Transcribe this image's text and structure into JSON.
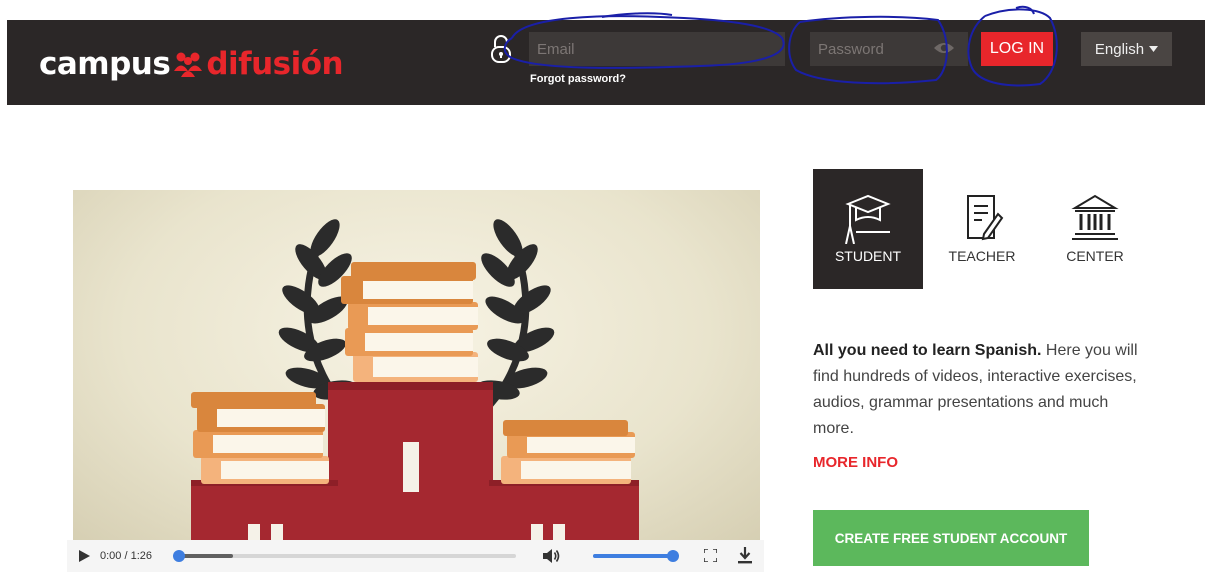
{
  "header": {
    "logo_part1": "campus",
    "logo_part2": "difusión",
    "email_placeholder": "Email",
    "password_placeholder": "Password",
    "forgot_password": "Forgot password?",
    "login_label": "LOG IN",
    "language": "English"
  },
  "video": {
    "time": "0:00 / 1:26",
    "buffered_fraction": 0.16,
    "played_fraction": 0.0,
    "volume_fraction": 1.0
  },
  "tabs": [
    {
      "label": "STUDENT",
      "icon": "graduation-cap-icon",
      "active": true
    },
    {
      "label": "TEACHER",
      "icon": "notepad-pencil-icon",
      "active": false
    },
    {
      "label": "CENTER",
      "icon": "institution-building-icon",
      "active": false
    }
  ],
  "panel": {
    "lead": "All you need to learn Spanish.",
    "body": " Here you will find hundreds of videos, interactive exercises, audios, grammar presentations and much more.",
    "more_info": "MORE INFO",
    "cta": "CREATE FREE STUDENT ACCOUNT"
  },
  "colors": {
    "brand_red": "#e8262b",
    "header_bg": "#2b2727",
    "cta_green": "#5cb85c",
    "player_blue": "#3e7ee0",
    "annotation_blue": "#1a1fa8"
  }
}
